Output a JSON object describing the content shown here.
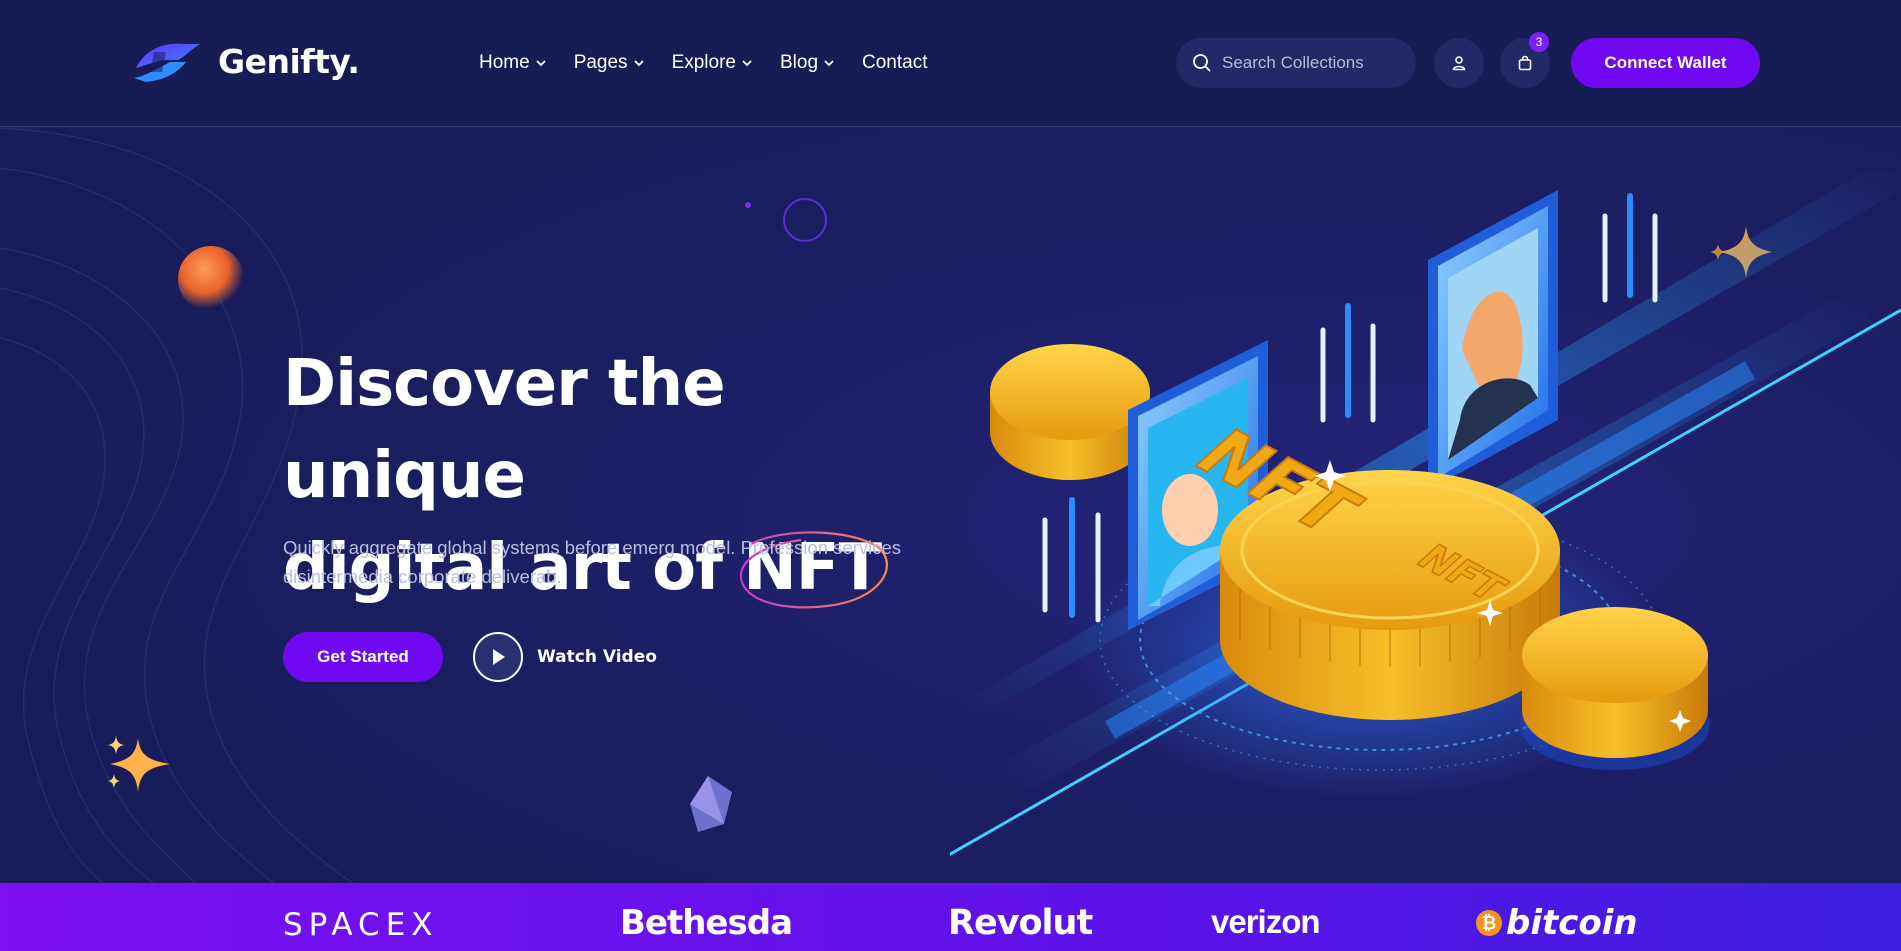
{
  "header": {
    "brand": "Genifty.",
    "nav": [
      {
        "label": "Home",
        "has_dropdown": true
      },
      {
        "label": "Pages",
        "has_dropdown": true
      },
      {
        "label": "Explore",
        "has_dropdown": true
      },
      {
        "label": "Blog",
        "has_dropdown": true
      },
      {
        "label": "Contact",
        "has_dropdown": false
      }
    ],
    "search": {
      "placeholder": "Search Collections",
      "icon": "search-icon"
    },
    "account_icon": "user-icon",
    "cart": {
      "icon": "shopping-bag-icon",
      "count": "3"
    },
    "connect_label": "Connect Wallet"
  },
  "hero": {
    "title_line1": "Discover the unique",
    "title_line2_prefix": "digital art of ",
    "title_highlight": "NFT",
    "description": "Quickly aggregate global systems before emerg model. Profession services disintermedia corporate deliverab.",
    "primary_cta": "Get Started",
    "video_cta": "Watch Video",
    "illustration_text": [
      "NFT",
      "NFT"
    ]
  },
  "brands": [
    "SPACEX",
    "Bethesda",
    "Revolut",
    "verizon",
    "bitcoin"
  ],
  "colors": {
    "background": "#1a1e5c",
    "accent": "#7108f2",
    "brand_strip": "#6a12ee",
    "coin_gold": "#f5b21a"
  }
}
